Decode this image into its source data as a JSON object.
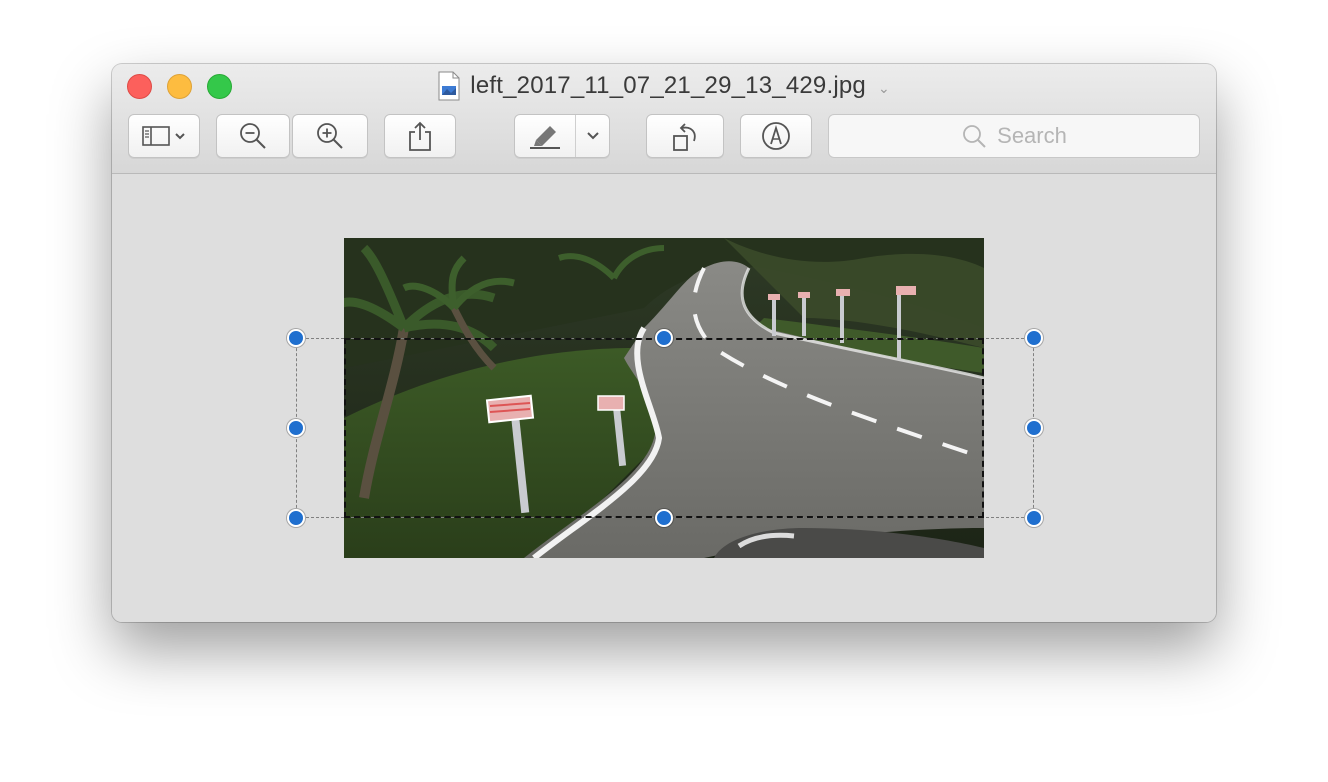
{
  "window": {
    "title": "left_2017_11_07_21_29_13_429.jpg",
    "title_icon": "jpeg-file-icon",
    "title_menu_icon": "chevron-down-icon"
  },
  "toolbar": {
    "sidebar_icon": "sidebar-icon",
    "zoom_out_icon": "zoom-out-icon",
    "zoom_in_icon": "zoom-in-icon",
    "share_icon": "share-icon",
    "markup_icon": "highlighter-icon",
    "rotate_icon": "rotate-left-icon",
    "annotate_icon": "markup-pen-icon",
    "search": {
      "placeholder": "Search",
      "icon": "search-icon"
    }
  },
  "colors": {
    "handle": "#1f6fcf",
    "close": "#fc605c",
    "minimize": "#fdbc40",
    "maximize": "#34c84a"
  }
}
